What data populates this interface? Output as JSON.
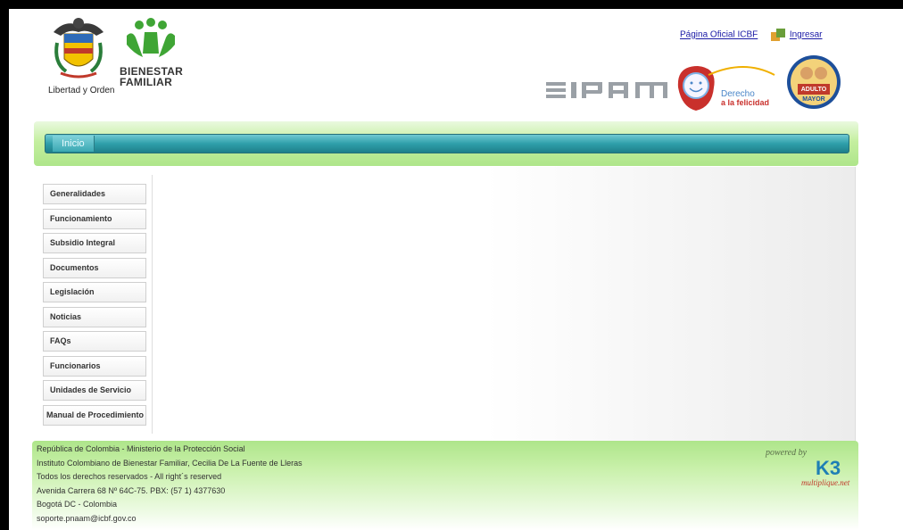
{
  "header": {
    "coat_caption": "Libertad y Orden",
    "icbf_line1": "BIENESTAR",
    "icbf_line2": "FAMILIAR",
    "link_official": "Página Oficial ICBF",
    "link_login": "Ingresar",
    "sipam_text": "SIPAM",
    "derecho_line1": "Derecho",
    "derecho_line2": "a la felicidad",
    "adulto_line1": "ADULTO",
    "adulto_line2": "MAYOR"
  },
  "nav": {
    "tabs": [
      {
        "label": "Inicio"
      }
    ]
  },
  "sidebar": {
    "items": [
      {
        "label": "Generalidades"
      },
      {
        "label": "Funcionamiento"
      },
      {
        "label": "Subsidio Integral"
      },
      {
        "label": "Documentos"
      },
      {
        "label": "Legislación"
      },
      {
        "label": "Noticias"
      },
      {
        "label": "FAQs"
      },
      {
        "label": "Funcionarios"
      },
      {
        "label": "Unidades de Servicio"
      },
      {
        "label": "Manual de Procedimiento"
      }
    ]
  },
  "footer": {
    "lines": [
      "República de Colombia - Ministerio de la Protección Social",
      "Instituto Colombiano de Bienestar Familiar, Cecilia De La Fuente de Lleras",
      "Todos los derechos reservados - All right´s reserved",
      "Avenida Carrera 68 Nº 64C-75. PBX: (57 1) 4377630",
      "Bogotá DC - Colombia",
      "soporte.pnaam@icbf.gov.co"
    ],
    "powered_by": "powered by",
    "brand": "K3",
    "brand_tagline": "multiplique.net"
  },
  "colors": {
    "nav_teal": "#2f9faa",
    "nav_green": "#aee58a",
    "link_blue": "#1a1aa6"
  },
  "icons": [
    "coat-of-arms-icon",
    "icbf-family-icon",
    "ingresar-icon",
    "sipam-logo",
    "derecho-felicidad-logo",
    "adulto-mayor-seal"
  ]
}
